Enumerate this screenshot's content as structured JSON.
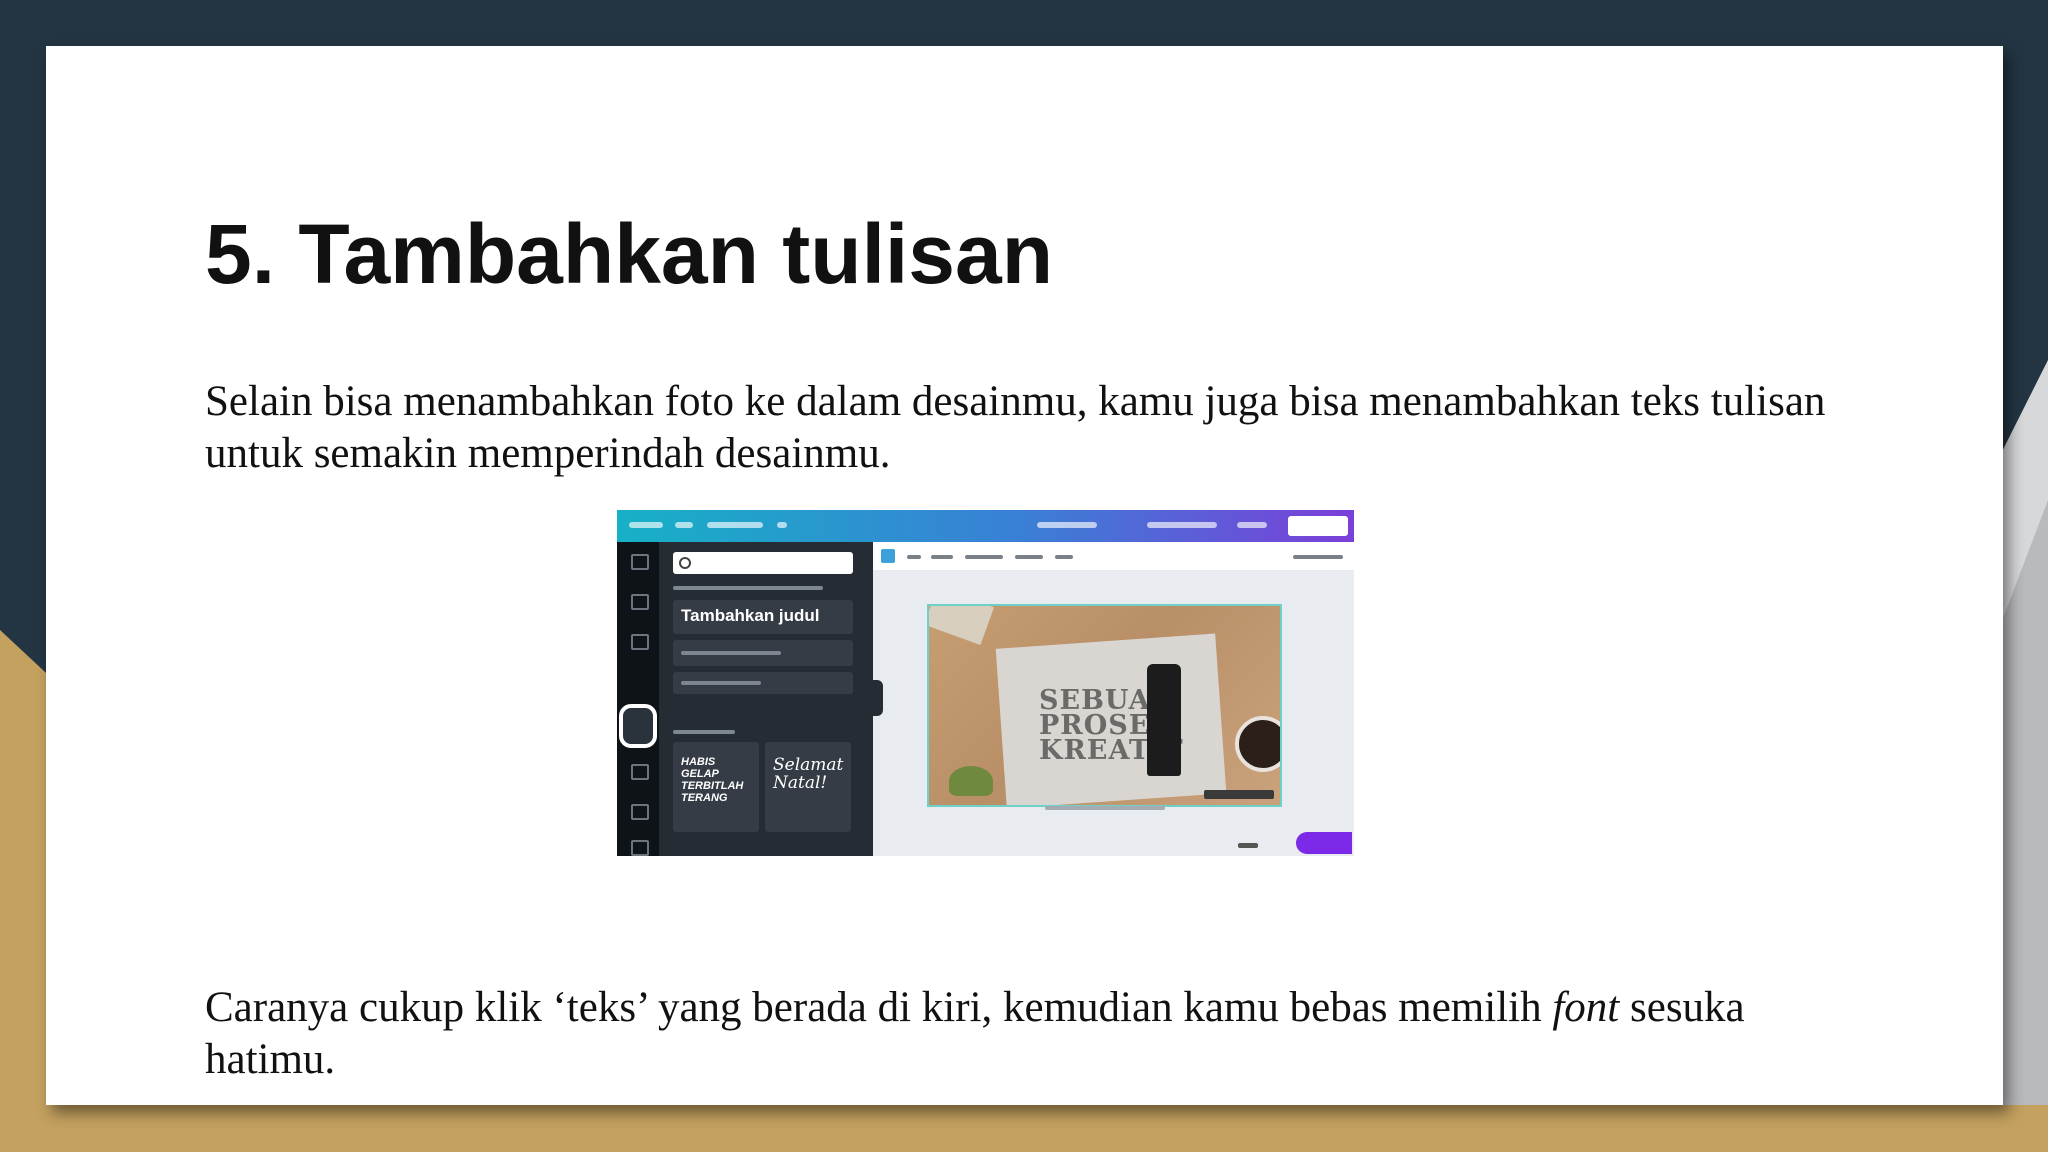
{
  "slide": {
    "title": "5. Tambahkan tulisan",
    "paragraph1": "Selain bisa menambahkan foto ke dalam desainmu, kamu juga bisa menambahkan teks tulisan untuk semakin memperindah desainmu.",
    "paragraph2_before": "Caranya cukup klik ‘teks’ yang berada di kiri, kemudian kamu bebas memilih ",
    "paragraph2_italic": "font",
    "paragraph2_after": " sesuka hatimu."
  },
  "screenshot": {
    "panel_heading": "Tambahkan judul",
    "tile1_text": "HABIS GELAP TERBITLAH TERANG",
    "tile2_text": "Selamat Natal!",
    "canvas_text": "SEBUAH PROSES KREATIF"
  },
  "colors": {
    "background_navy": "#233543",
    "accent_gold": "#c4a15f",
    "canva_purple": "#7d2ae8"
  }
}
